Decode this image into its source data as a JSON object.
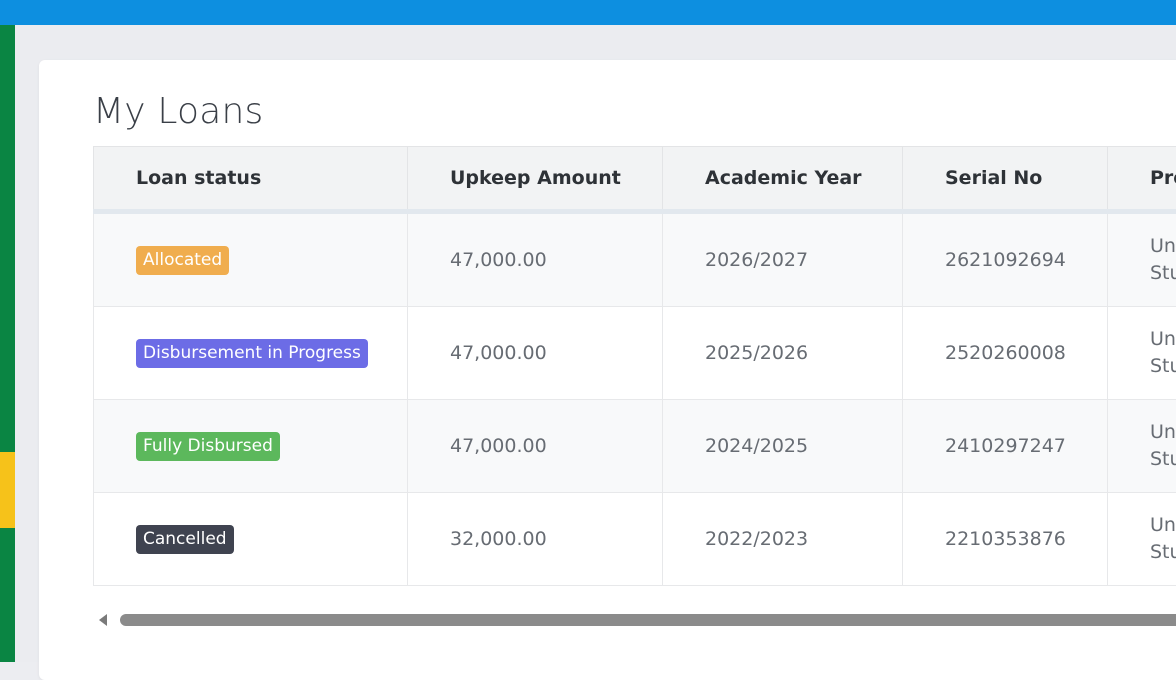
{
  "page": {
    "title": "My Loans"
  },
  "table": {
    "headers": [
      "Loan status",
      "Upkeep Amount",
      "Academic Year",
      "Serial No",
      "Pro"
    ],
    "rows": [
      {
        "status": "Allocated",
        "status_color": "#f0ad4e",
        "amount": "47,000.00",
        "year": "2026/2027",
        "serial": "2621092694",
        "program_line1": "Un",
        "program_line2": "Stu"
      },
      {
        "status": "Disbursement in Progress",
        "status_color": "#6c6ce6",
        "amount": "47,000.00",
        "year": "2025/2026",
        "serial": "2520260008",
        "program_line1": "Un",
        "program_line2": "Stu"
      },
      {
        "status": "Fully Disbursed",
        "status_color": "#5cb85c",
        "amount": "47,000.00",
        "year": "2024/2025",
        "serial": "2410297247",
        "program_line1": "Un",
        "program_line2": "Stu"
      },
      {
        "status": "Cancelled",
        "status_color": "#3f4350",
        "amount": "32,000.00",
        "year": "2022/2023",
        "serial": "2210353876",
        "program_line1": "Un",
        "program_line2": "Stu"
      }
    ]
  },
  "colors": {
    "topbar": "#0d8fe0",
    "sidebar": "#0a8543",
    "sidebar_accent": "#f6c21a"
  },
  "icons": {
    "scroll_left": "scroll-left-arrow-icon"
  }
}
